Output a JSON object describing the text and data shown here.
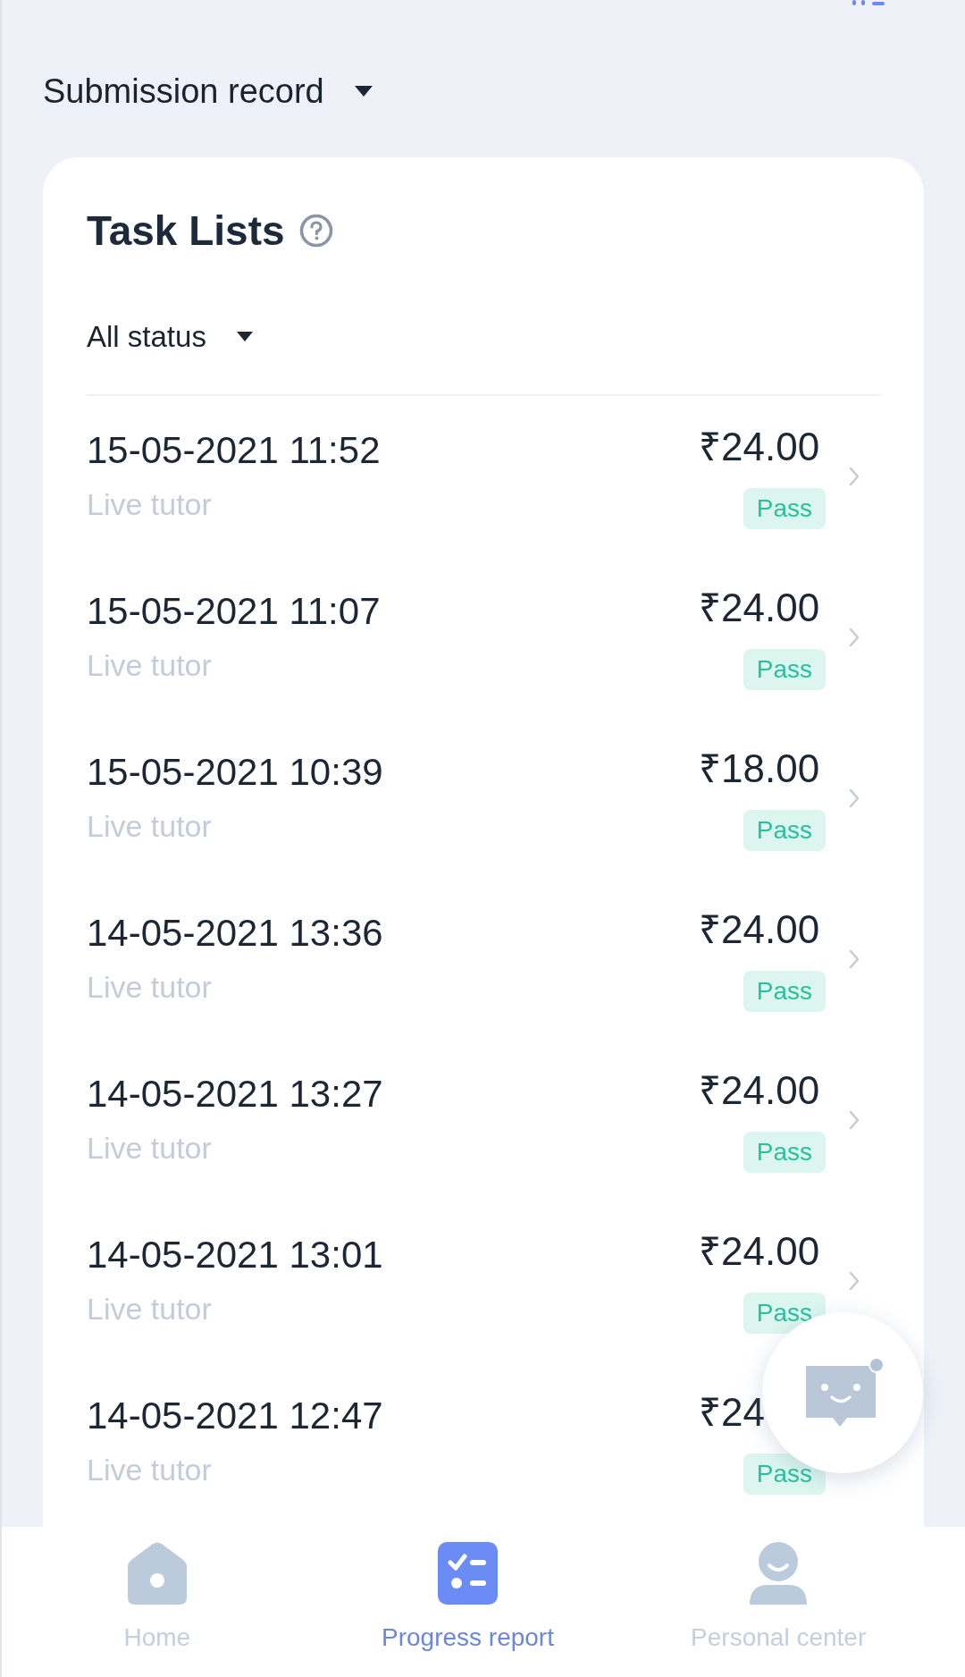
{
  "header": {
    "title": "Submission record"
  },
  "card": {
    "title": "Task Lists",
    "filter": "All status",
    "tasks": [
      {
        "date": "15-05-2021 11:52",
        "type": "Live tutor",
        "amount": "₹24.00",
        "status": "Pass"
      },
      {
        "date": "15-05-2021 11:07",
        "type": "Live tutor",
        "amount": "₹24.00",
        "status": "Pass"
      },
      {
        "date": "15-05-2021 10:39",
        "type": "Live tutor",
        "amount": "₹18.00",
        "status": "Pass"
      },
      {
        "date": "14-05-2021 13:36",
        "type": "Live tutor",
        "amount": "₹24.00",
        "status": "Pass"
      },
      {
        "date": "14-05-2021 13:27",
        "type": "Live tutor",
        "amount": "₹24.00",
        "status": "Pass"
      },
      {
        "date": "14-05-2021 13:01",
        "type": "Live tutor",
        "amount": "₹24.00",
        "status": "Pass"
      },
      {
        "date": "14-05-2021 12:47",
        "type": "Live tutor",
        "amount": "₹24",
        "status": "Pass"
      }
    ]
  },
  "nav": [
    {
      "kind": "home",
      "label": "Home",
      "selected": false
    },
    {
      "kind": "report",
      "label": "Progress report",
      "selected": true
    },
    {
      "kind": "person",
      "label": "Personal center",
      "selected": false
    }
  ]
}
